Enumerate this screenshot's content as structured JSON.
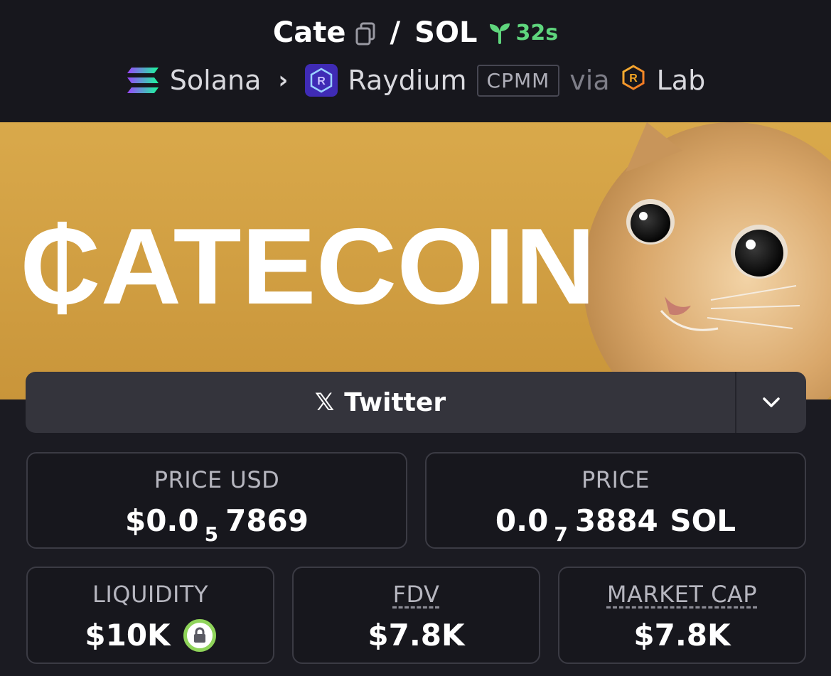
{
  "header": {
    "base_token": "Cate",
    "separator": "/",
    "quote_token": "SOL",
    "pair_age": "32s",
    "chain": "Solana",
    "dex": "Raydium",
    "pool_type": "CPMM",
    "via_label": "via",
    "launchpad": "Lab"
  },
  "banner": {
    "text": "₵ATECOIN"
  },
  "socials": {
    "primary_label": "Twitter"
  },
  "stats": {
    "price_usd": {
      "label": "PRICE USD",
      "prefix": "$0.0",
      "zeros": "5",
      "digits": "7869",
      "suffix": ""
    },
    "price_native": {
      "label": "PRICE",
      "prefix": "0.0",
      "zeros": "7",
      "digits": "3884",
      "suffix": " SOL"
    },
    "liquidity": {
      "label": "LIQUIDITY",
      "value": "$10K"
    },
    "fdv": {
      "label": "FDV",
      "value": "$7.8K"
    },
    "market_cap": {
      "label": "MARKET CAP",
      "value": "$7.8K"
    }
  },
  "colors": {
    "accent_green": "#5fd67d",
    "lock_ring": "#8fd45a",
    "raydium_purple": "#3f2bb5",
    "banner_gold": "#d6a544"
  }
}
